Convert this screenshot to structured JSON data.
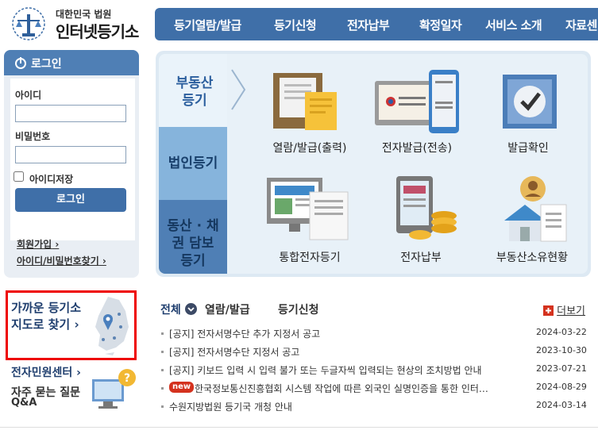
{
  "header": {
    "logo_small": "대한민국 법원",
    "logo_big": "인터넷등기소",
    "menu": [
      "등기열람/발급",
      "등기신청",
      "전자납부",
      "확정일자",
      "서비스 소개",
      "자료센"
    ]
  },
  "login": {
    "title": "로그인",
    "id_label": "아이디",
    "pw_label": "비밀번호",
    "id_value": "",
    "pw_value": "",
    "save_id": "아이디저장",
    "button": "로그인",
    "signup": "회원가입",
    "find": "아이디/비밀번호찾기"
  },
  "services": {
    "tabs": [
      "부동산 등기",
      "법인등기",
      "동산 · 채권 담보 등기"
    ],
    "items": [
      "열람/발급(출력)",
      "전자발급(전송)",
      "발급확인",
      "통합전자등기",
      "전자납부",
      "부동산소유현황"
    ]
  },
  "side": {
    "map_line1": "가까운 등기소",
    "map_line2": "지도로 찾기",
    "civil_center": "전자민원센터",
    "faq1": "자주 묻는 질문",
    "faq2": "Q&A"
  },
  "notices": {
    "tabs": [
      "전체",
      "열람/발급",
      "등기신청"
    ],
    "more": "더보기",
    "new_badge": "new",
    "items": [
      {
        "title": "[공지] 전자서명수단 추가 지정서 공고",
        "date": "2024-03-22"
      },
      {
        "title": "[공지] 전자서명수단 지정서 공고",
        "date": "2023-10-30"
      },
      {
        "title": "[공지] 키보드 입력 시 입력 불가 또는 두글자씩 입력되는 현상의 조치방법 안내",
        "date": "2023-07-21"
      },
      {
        "title": "한국정보통신진흥협회 시스템 작업에 따른 외국인 실명인증을 통한 인터…",
        "date": "2024-08-29"
      },
      {
        "title": "수원지방법원 등기국 개청 안내",
        "date": "2024-03-14"
      }
    ]
  },
  "colors": {
    "brand": "#3f6fa8",
    "highlight": "#e00000",
    "new": "#d4321e"
  }
}
